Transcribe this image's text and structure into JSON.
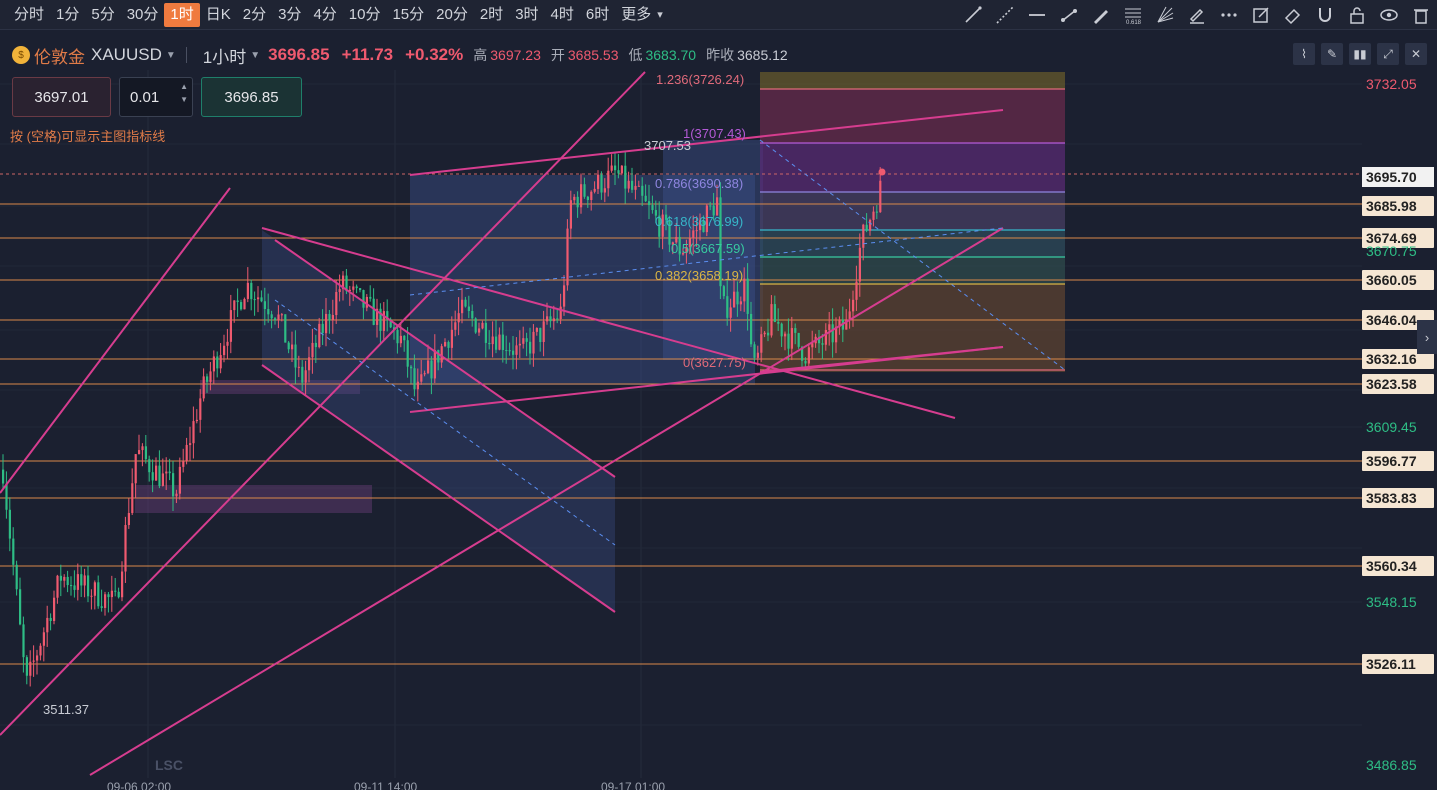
{
  "toolbar": {
    "timeframes": [
      "分时",
      "1分",
      "5分",
      "30分",
      "1时",
      "日K",
      "2分",
      "3分",
      "4分",
      "10分",
      "15分",
      "20分",
      "2时",
      "3时",
      "4时",
      "6时",
      "更多"
    ],
    "active_timeframe": "1时",
    "more_caret": "▾",
    "tools": [
      "trend-line-icon",
      "extended-line-icon",
      "horizontal-line-icon",
      "ray-line-icon",
      "pen-line-icon",
      "fib-retracement-icon",
      "fan-icon",
      "brush-icon",
      "more-dots-icon",
      "note-icon",
      "eraser-icon",
      "magnet-icon",
      "lock-icon",
      "eye-icon",
      "trash-icon"
    ]
  },
  "symbol": {
    "coin_glyph": "$",
    "name": "伦敦金",
    "code": "XAUUSD",
    "interval": "1小时",
    "price": "3696.85",
    "change": "+11.73",
    "change_pct": "+0.32%",
    "high_label": "高",
    "high": "3697.23",
    "open_label": "开",
    "open": "3685.53",
    "low_label": "低",
    "low": "3683.70",
    "prev_label": "昨收",
    "prev": "3685.12"
  },
  "order": {
    "sell_price": "3697.01",
    "quantity": "0.01",
    "buy_price": "3696.85",
    "hint": "按 (空格)可显示主图指标线"
  },
  "price_axis": [
    {
      "value": "3732.05",
      "style": "plain-red"
    },
    {
      "value": "3695.70",
      "style": "tag-white"
    },
    {
      "value": "3685.98",
      "style": "tag"
    },
    {
      "value": "3674.69",
      "style": "tag"
    },
    {
      "value": "3670.75",
      "style": "plain-green"
    },
    {
      "value": "3660.05",
      "style": "tag"
    },
    {
      "value": "3646.04",
      "style": "tag"
    },
    {
      "value": "3632.16",
      "style": "tag"
    },
    {
      "value": "3623.58",
      "style": "tag"
    },
    {
      "value": "3609.45",
      "style": "plain-green"
    },
    {
      "value": "3596.77",
      "style": "tag"
    },
    {
      "value": "3583.83",
      "style": "tag"
    },
    {
      "value": "3560.34",
      "style": "tag"
    },
    {
      "value": "3548.15",
      "style": "plain-green"
    },
    {
      "value": "3526.11",
      "style": "tag"
    },
    {
      "value": "3486.85",
      "style": "plain-green"
    }
  ],
  "x_axis": [
    "09-06 02:00",
    "09-11 14:00",
    "09-17 01:00"
  ],
  "chart_annotations": {
    "high_marker": "3707.53",
    "low_marker": "3511.37",
    "fib_levels": [
      {
        "label": "1.236(3726.24)",
        "color": "#e06a7a"
      },
      {
        "label": "1(3707.43)",
        "color": "#b35ad6"
      },
      {
        "label": "0.786(3690.38)",
        "color": "#8f86e0"
      },
      {
        "label": "0.618(3676.99)",
        "color": "#37b6c9"
      },
      {
        "label": "0.5(3667.59)",
        "color": "#38c9a0"
      },
      {
        "label": "0.382(3658.19)",
        "color": "#d9b545"
      },
      {
        "label": "0(3627.75)",
        "color": "#e06a7a"
      }
    ],
    "watermark": "LSC"
  },
  "side_arrow": "›",
  "colors": {
    "up": "#ef5a6f",
    "down": "#2ebd85",
    "accent": "#f07b3f",
    "drawing": "#d63d8f",
    "level": "#d9894a"
  }
}
